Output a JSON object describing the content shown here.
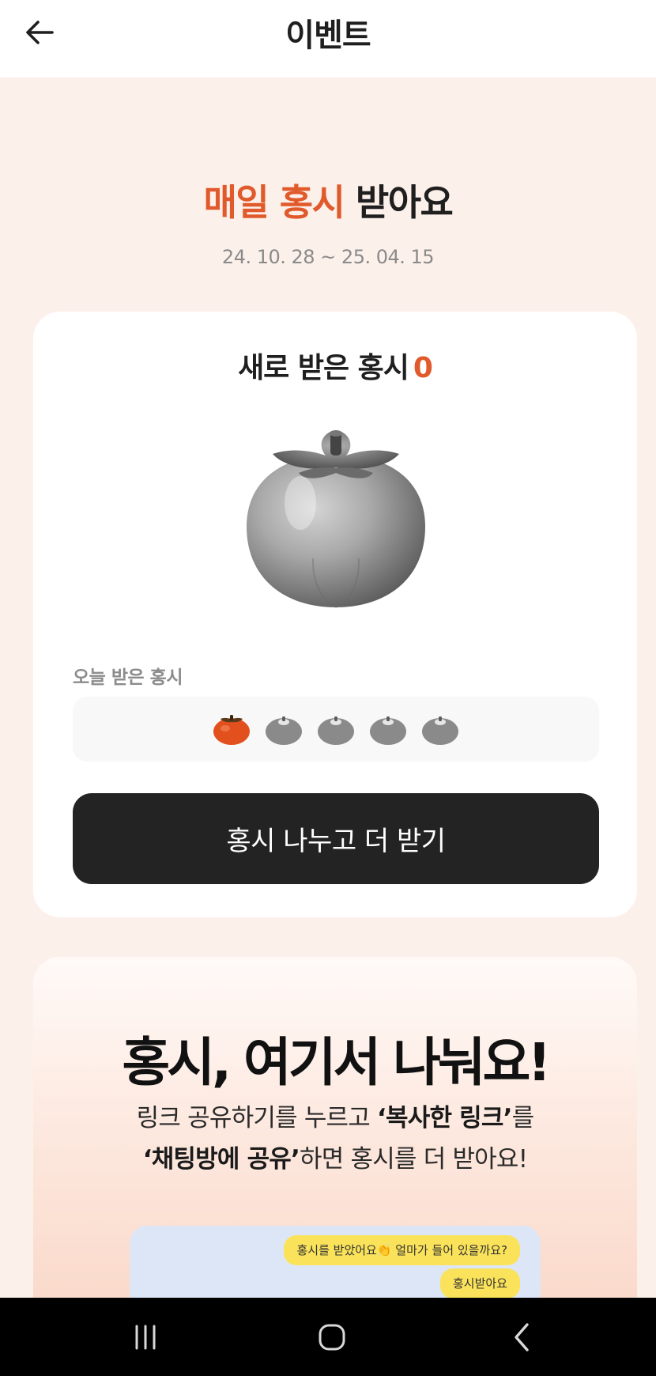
{
  "topbar": {
    "title": "이벤트",
    "back_icon": "arrow-left-icon"
  },
  "hero": {
    "title_accent": "매일 홍시",
    "title_rest": " 받아요",
    "period": "24. 10. 28 ~ 25. 04. 15",
    "accent_color": "#e05a2b"
  },
  "received": {
    "title": "새로 받은 홍시",
    "count": "0",
    "today_label": "오늘 받은 홍시",
    "today_slots": [
      {
        "state": "filled"
      },
      {
        "state": "empty"
      },
      {
        "state": "empty"
      },
      {
        "state": "empty"
      },
      {
        "state": "empty"
      }
    ],
    "share_button": "홍시 나누고 더 받기"
  },
  "guide": {
    "title": "홍시, 여기서 나눠요!",
    "line1_a": "링크 공유하기를 누르고 ",
    "line1_b": "‘복사한 링크’",
    "line1_c": "를",
    "line2_a": "‘채팅방에 공유’",
    "line2_b": "하면 홍시를 더 받아요!",
    "chat_bubble_1": "홍시를 받았어요👏 얼마가 들어 있을까요?",
    "chat_bubble_2": "홍시받아요"
  },
  "navbar": {
    "recent_icon": "recent-apps-icon",
    "home_icon": "home-icon",
    "back_icon": "nav-back-icon"
  }
}
